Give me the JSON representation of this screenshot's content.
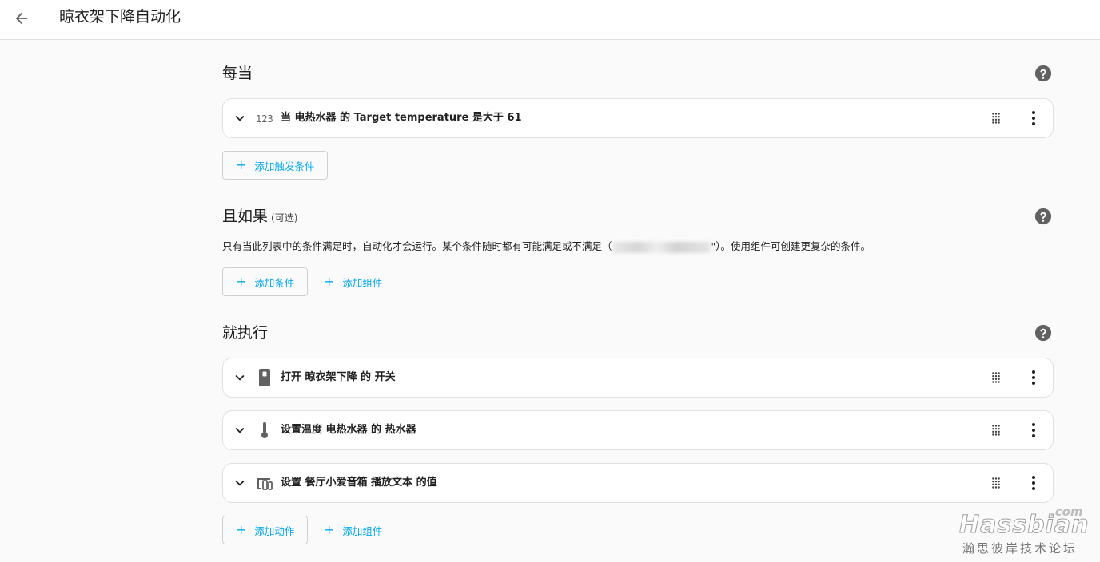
{
  "header": {
    "title": "晾衣架下降自动化",
    "back_icon": "arrow-left-icon"
  },
  "triggers": {
    "title": "每当",
    "items": [
      {
        "icon": "numeric-123-icon",
        "text": "当 电热水器 的 Target temperature 是大于 61"
      }
    ],
    "add_label": "添加触发条件"
  },
  "conditions": {
    "title": "且如果",
    "optional": "(可选)",
    "description_before": "只有当此列表中的条件满足时，自动化才会运行。某个条件随时都有可能满足或不满足（",
    "description_after": "\"）。使用组件可创建更复杂的条件。",
    "add_label": "添加条件",
    "add_group_label": "添加组件"
  },
  "actions": {
    "title": "就执行",
    "items": [
      {
        "icon": "light-switch-icon",
        "text": "打开 晾衣架下降 的 开关"
      },
      {
        "icon": "thermometer-icon",
        "text": "设置温度 电热水器 的 热水器"
      },
      {
        "icon": "devices-icon",
        "text": "设置 餐厅小爱音箱 播放文本 的值"
      }
    ],
    "add_label": "添加动作",
    "add_group_label": "添加组件"
  },
  "watermark": {
    "com": ".com",
    "brand": "Hassbian",
    "sub": "瀚思彼岸技术论坛"
  },
  "colors": {
    "accent": "#03a9f4",
    "background": "#fafafa",
    "card": "#ffffff",
    "icon": "#616161"
  }
}
